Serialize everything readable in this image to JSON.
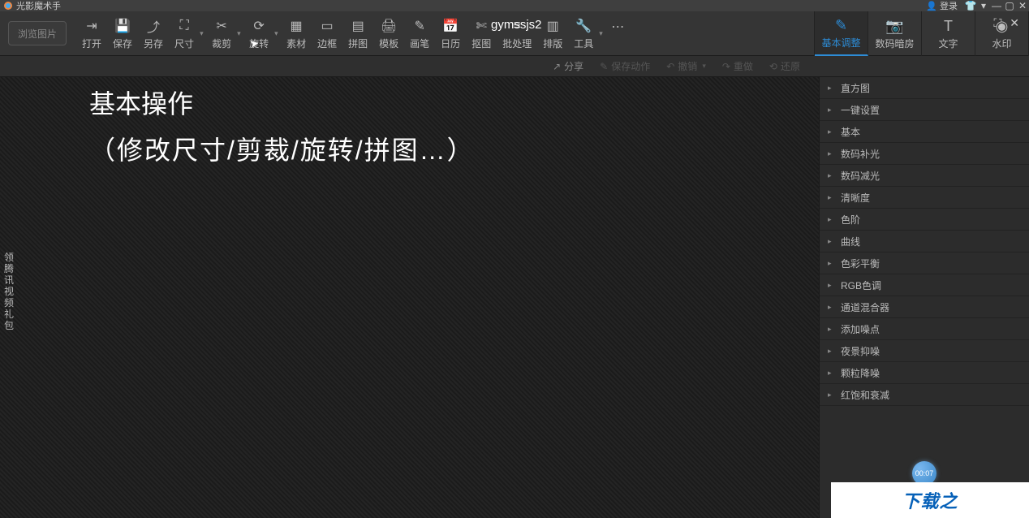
{
  "titlebar": {
    "app_name": "光影魔术手",
    "login": "登录"
  },
  "toolbar": {
    "browse": "浏览图片",
    "items": [
      {
        "label": "打开"
      },
      {
        "label": "保存"
      },
      {
        "label": "另存"
      },
      {
        "label": "尺寸",
        "dd": true
      },
      {
        "label": "裁剪",
        "dd": true
      },
      {
        "label": "旋转",
        "dd": true
      },
      {
        "label": "素材"
      },
      {
        "label": "边框"
      },
      {
        "label": "拼图"
      },
      {
        "label": "模板"
      },
      {
        "label": "画笔"
      },
      {
        "label": "日历"
      },
      {
        "label": "抠图"
      },
      {
        "label": "批处理"
      },
      {
        "label": "排版"
      },
      {
        "label": "工具",
        "dd": true
      }
    ],
    "overlay": "gymssjs2"
  },
  "right_tabs": [
    {
      "label": "基本调整",
      "active": true
    },
    {
      "label": "数码暗房"
    },
    {
      "label": "文字"
    },
    {
      "label": "水印"
    }
  ],
  "actionbar": {
    "share": "分享",
    "save_action": "保存动作",
    "undo": "撤销",
    "redo": "重做",
    "restore": "还原"
  },
  "canvas": {
    "line1": "基本操作",
    "line2": "（修改尺寸/剪裁/旋转/拼图…）",
    "side_ad": "领腾讯视频礼包"
  },
  "panel_items": [
    "直方图",
    "一键设置",
    "基本",
    "数码补光",
    "数码减光",
    "清晰度",
    "色阶",
    "曲线",
    "色彩平衡",
    "RGB色调",
    "通道混合器",
    "添加噪点",
    "夜景抑噪",
    "颗粒降噪",
    "红饱和衰减"
  ],
  "timer": "00:07",
  "ad_text": "下载之"
}
